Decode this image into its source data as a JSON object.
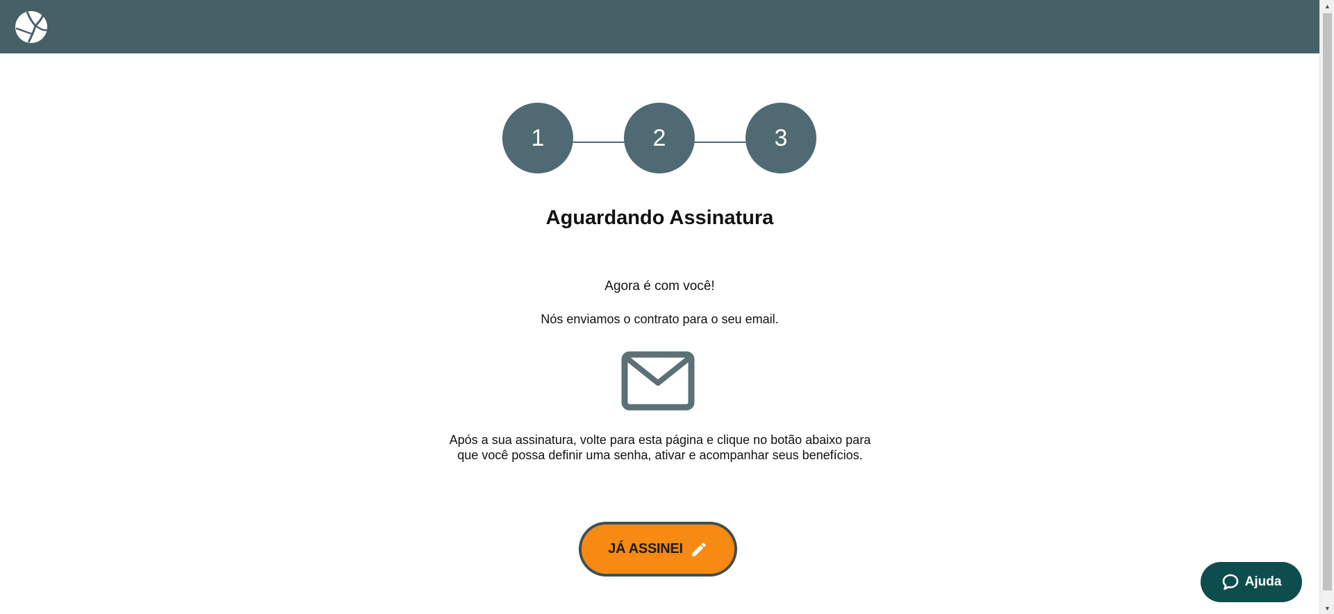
{
  "header": {
    "logo_icon": "leaf-globe-logo-icon",
    "bar_color": "#476066"
  },
  "stepper": {
    "steps": [
      "1",
      "2",
      "3"
    ],
    "step_color": "#4f6a72"
  },
  "main": {
    "title": "Aguardando Assinatura",
    "lead": "Agora é com você!",
    "sent_message": "Nós enviamos o contrato para o seu email.",
    "mail_icon": "envelope-icon",
    "instructions": "Após a sua assinatura, volte para esta página e clique no botão abaixo para que você possa definir uma senha, ativar e acompanhar seus benefícios."
  },
  "cta": {
    "label": "JÁ ASSINEI",
    "icon": "pencil-icon",
    "color": "#f68a12"
  },
  "help": {
    "label": "Ajuda",
    "icon": "chat-bubble-icon",
    "color": "#0e4d4d"
  }
}
